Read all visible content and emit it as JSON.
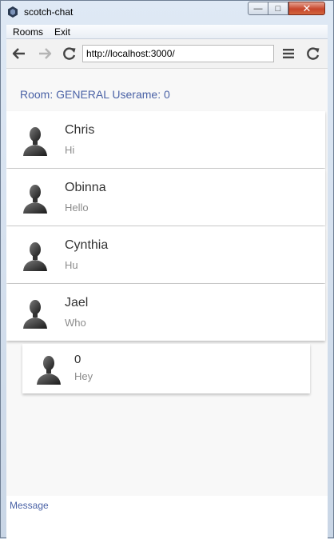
{
  "window": {
    "title": "scotch-chat",
    "controls": {
      "minimize": "—",
      "maximize": "□",
      "close": "✕"
    }
  },
  "menu": {
    "items": [
      "Rooms",
      "Exit"
    ]
  },
  "toolbar": {
    "url": "http://localhost:3000/",
    "icons": [
      "back-arrow-icon",
      "forward-arrow-icon",
      "reload-icon",
      "hamburger-menu-icon",
      "refresh-icon"
    ]
  },
  "room": {
    "header": "Room: GENERAL Userame: 0"
  },
  "messages": [
    {
      "name": "Chris",
      "text": "Hi"
    },
    {
      "name": "Obinna",
      "text": "Hello"
    },
    {
      "name": "Cynthia",
      "text": "Hu"
    },
    {
      "name": "Jael",
      "text": "Who"
    },
    {
      "name": "0",
      "text": "Hey"
    }
  ],
  "compose": {
    "label": "Message"
  },
  "colors": {
    "accent": "#4a62a6",
    "closeButton": "#c7462c",
    "muted": "#8c8c8c"
  }
}
